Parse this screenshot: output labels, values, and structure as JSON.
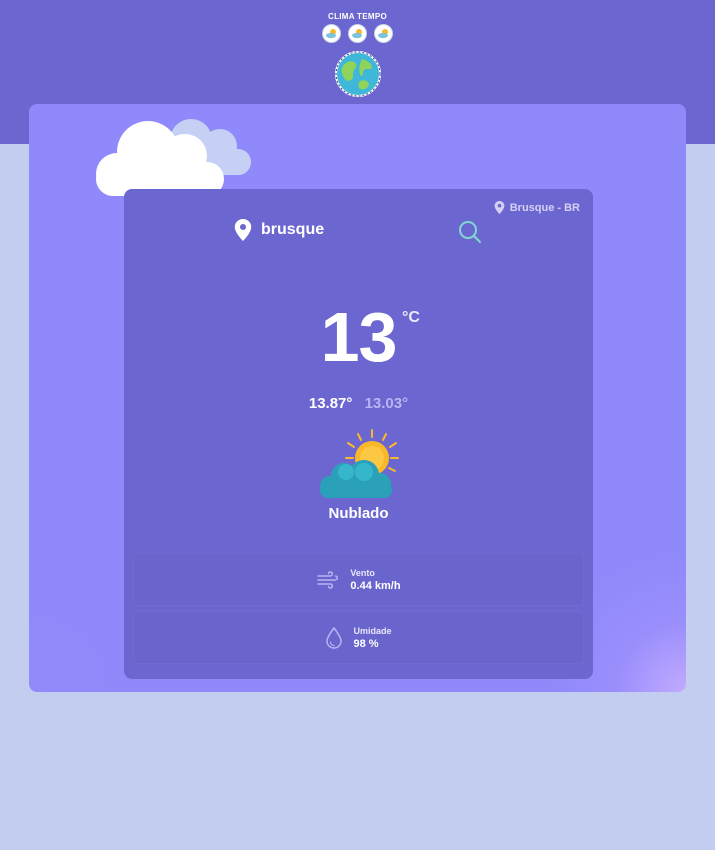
{
  "app": {
    "brand_title": "CLIMA TEMPO"
  },
  "header": {
    "mini_icons": [
      "cloud-sun-icon",
      "cloud-sun-icon",
      "cloud-sun-icon"
    ],
    "logo": "globe-icon"
  },
  "search": {
    "query": "brusque",
    "location_badge": "Brusque - BR"
  },
  "weather": {
    "temperature": "13",
    "unit": "°C",
    "temp_max": "13.87°",
    "temp_min": "13.03°",
    "condition": "Nublado",
    "condition_icon": "sun-behind-cloud-icon"
  },
  "stats": {
    "wind": {
      "label": "Vento",
      "value": "0.44 km/h",
      "icon": "wind-icon"
    },
    "humidity": {
      "label": "Umidade",
      "value": "98 %",
      "icon": "droplet-icon"
    }
  },
  "colors": {
    "header_bg": "#6c67d0",
    "panel_bg": "#8f89fb",
    "card_bg": "#6c67d0",
    "page_bg": "#c3cdf0",
    "search_icon": "#7fd9d1",
    "sun": "#f9b82a",
    "cloud": "#2aa1b8"
  }
}
